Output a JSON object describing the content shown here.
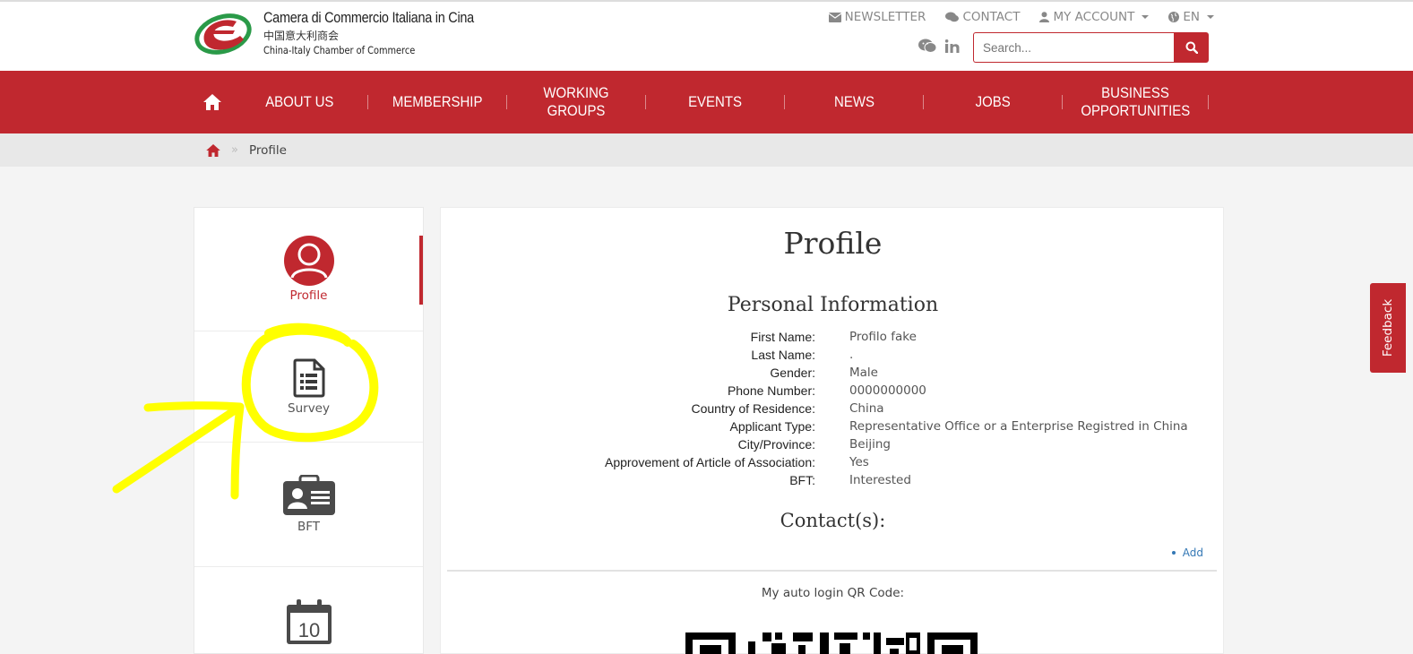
{
  "header": {
    "logo": {
      "line1": "Camera di Commercio Italiana in Cina",
      "line2": "中国意大利商会",
      "line3": "China-Italy Chamber of Commerce"
    },
    "top_links": {
      "newsletter": "NEWSLETTER",
      "contact": "CONTACT",
      "my_account": "MY ACCOUNT",
      "language": "EN"
    },
    "search": {
      "placeholder": "Search..."
    }
  },
  "nav": {
    "items": [
      "ABOUT US",
      "MEMBERSHIP",
      "WORKING GROUPS",
      "EVENTS",
      "NEWS",
      "JOBS"
    ],
    "business": {
      "line1": "BUSINESS",
      "line2": "OPPORTUNITIES"
    }
  },
  "breadcrumb": {
    "separator": "»",
    "current": "Profile"
  },
  "sidebar": {
    "items": [
      {
        "label": "Profile",
        "icon": "user-avatar-icon",
        "active": true
      },
      {
        "label": "Survey",
        "icon": "survey-document-icon"
      },
      {
        "label": "BFT",
        "icon": "id-badge-icon"
      },
      {
        "label": "",
        "icon": "calendar-icon",
        "calendar_day": "10"
      }
    ]
  },
  "main": {
    "title": "Profile",
    "section_title": "Personal Information",
    "fields": [
      {
        "key": "First Name:",
        "value": "Profilo fake"
      },
      {
        "key": "Last Name:",
        "value": "."
      },
      {
        "key": "Gender:",
        "value": "Male"
      },
      {
        "key": "Phone Number:",
        "value": "0000000000"
      },
      {
        "key": "Country of Residence:",
        "value": "China"
      },
      {
        "key": "Applicant Type:",
        "value": "Representative Office or a Enterprise Registred in China"
      },
      {
        "key": "City/Province:",
        "value": "Beijing"
      },
      {
        "key": "Approvement of Article of Association:",
        "value": "Yes"
      },
      {
        "key": "BFT:",
        "value": "Interested"
      }
    ],
    "contacts_title": "Contact(s):",
    "add_label": "Add",
    "qr_label": "My auto login QR Code:"
  },
  "feedback": {
    "label": "Feedback"
  },
  "colors": {
    "brand_red": "#c0282f",
    "annotation_yellow": "#ffff00",
    "link_blue": "#3478b5"
  }
}
